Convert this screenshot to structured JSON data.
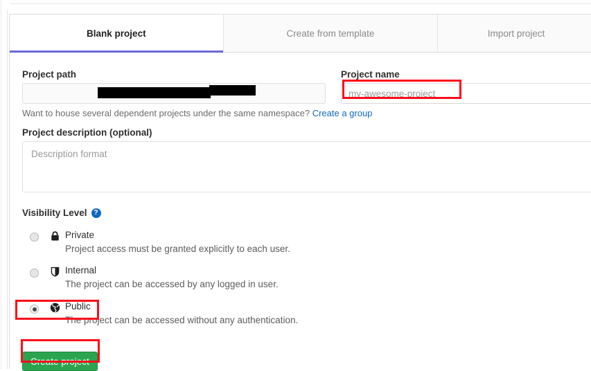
{
  "tabs": [
    {
      "label": "Blank project",
      "active": true
    },
    {
      "label": "Create from template",
      "active": false
    },
    {
      "label": "Import project",
      "active": false
    }
  ],
  "form": {
    "project_path": {
      "label": "Project path",
      "value": "",
      "redacted": true
    },
    "project_name": {
      "label": "Project name",
      "placeholder": "my-awesome-project",
      "value": ""
    },
    "namespace_help": {
      "text": "Want to house several dependent projects under the same namespace?",
      "link_label": "Create a group"
    },
    "project_description": {
      "label": "Project description (optional)",
      "placeholder": "Description format",
      "value": ""
    }
  },
  "visibility": {
    "label": "Visibility Level",
    "help_icon_glyph": "?",
    "options": [
      {
        "name": "Private",
        "description": "Project access must be granted explicitly to each user.",
        "icon": "lock-icon",
        "selected": false
      },
      {
        "name": "Internal",
        "description": "The project can be accessed by any logged in user.",
        "icon": "shield-icon",
        "selected": false
      },
      {
        "name": "Public",
        "description": "The project can be accessed without any authentication.",
        "icon": "globe-icon",
        "selected": true
      }
    ]
  },
  "actions": {
    "create_project_label": "Create project"
  },
  "colors": {
    "active_tab_underline": "#6b69d6",
    "link": "#1068bf",
    "help_badge": "#1068bf",
    "create_button": "#2ca44f",
    "annotation_box": "#fc0d1b",
    "redaction": "#000000"
  },
  "annotations": [
    {
      "target": "project-name-input",
      "color": "#fc0d1b"
    },
    {
      "target": "visibility-option-public",
      "color": "#fc0d1b"
    },
    {
      "target": "create-project-button",
      "color": "#fc0d1b"
    }
  ]
}
